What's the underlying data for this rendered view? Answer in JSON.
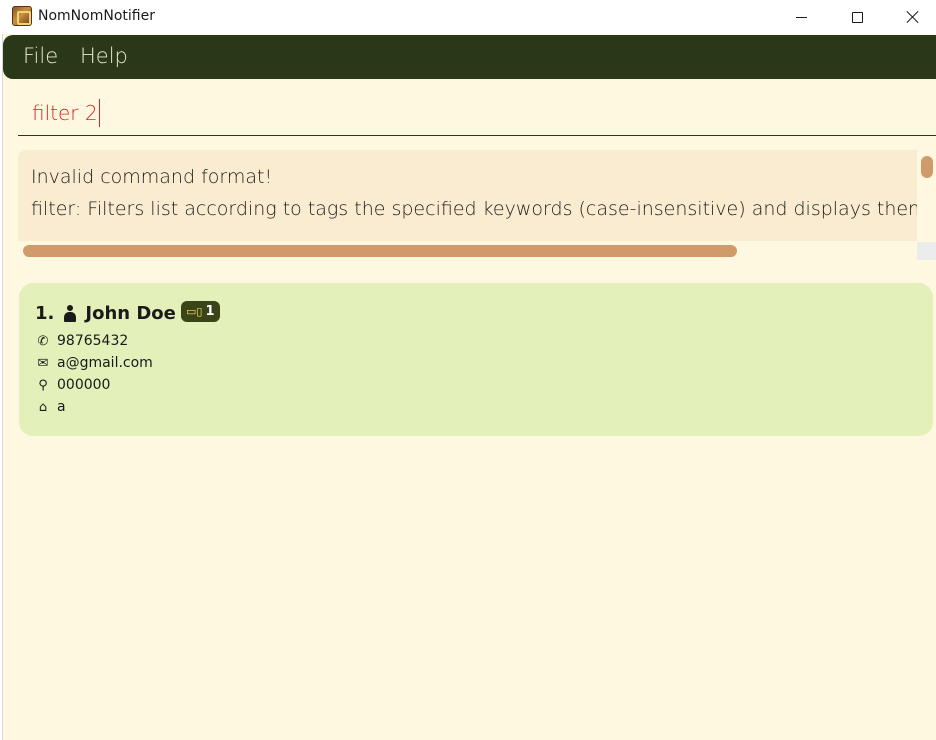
{
  "window": {
    "title": "NomNomNotifier"
  },
  "menu": {
    "file": "File",
    "help": "Help"
  },
  "command_box": {
    "value": "filter 2"
  },
  "result_display": {
    "line1": "Invalid command format!",
    "line2": "filter: Filters list according to tags the specified keywords (case-insensitive) and displays them as a l"
  },
  "persons": [
    {
      "index": "1.",
      "name": "John Doe",
      "tag": "1",
      "phone": "98765432",
      "email": "a@gmail.com",
      "postal": "000000",
      "address": "a"
    }
  ],
  "icons": {
    "person": "person-icon",
    "phone": "phone-icon",
    "email": "email-icon",
    "postal": "pin-icon",
    "address": "home-icon",
    "tag": "tag-icon"
  },
  "colors": {
    "menubar": "#2b3818",
    "background": "#fff8e0",
    "result_bg": "#faecd0",
    "card_bg": "#e3f0b9",
    "command_text": "#e02020",
    "scroll_thumb": "#d09a6a"
  }
}
